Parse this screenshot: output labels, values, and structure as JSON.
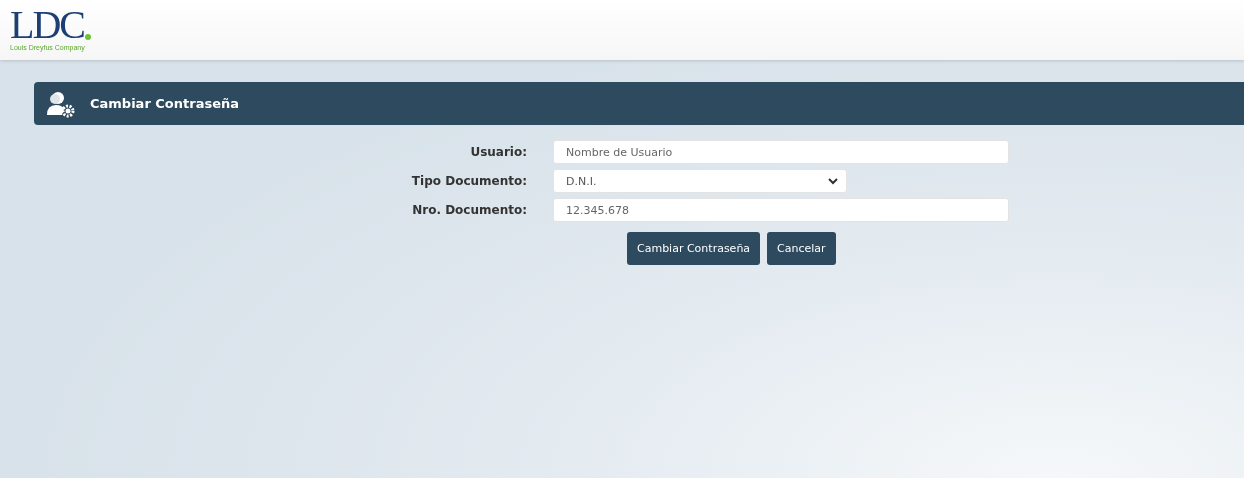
{
  "header": {
    "logo": {
      "text": "LDC",
      "tagline": "Louis Dreyfus Company"
    }
  },
  "panel": {
    "title": "Cambiar Contraseña"
  },
  "form": {
    "fields": [
      {
        "kind": "text",
        "label": "Usuario:",
        "placeholder": "Nombre de Usuario"
      },
      {
        "kind": "select",
        "label": "Tipo Documento:",
        "value": "D.N.I."
      },
      {
        "kind": "text",
        "label": "Nro. Documento:",
        "placeholder": "12.345.678"
      }
    ],
    "buttons": [
      "Cambiar Contraseña",
      "Cancelar"
    ]
  }
}
